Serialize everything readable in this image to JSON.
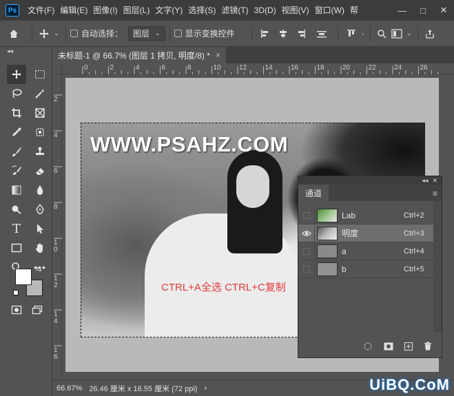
{
  "app": {
    "logo_text": "Ps"
  },
  "menu": [
    "文件(F)",
    "编辑(E)",
    "图像(I)",
    "图层(L)",
    "文字(Y)",
    "选择(S)",
    "滤镜(T)",
    "3D(D)",
    "视图(V)",
    "窗口(W)",
    "帮"
  ],
  "window_controls": {
    "minimize": "—",
    "maximize": "□",
    "close": "✕"
  },
  "options": {
    "auto_select_label": "自动选择：",
    "layer_select_value": "图层",
    "show_transform_label": "显示变换控件"
  },
  "document_tab": {
    "title": "未标题-1 @ 66.7% (图层 1 拷贝, 明度/8) *",
    "close": "×"
  },
  "ruler": {
    "h_ticks": [
      "0",
      "2",
      "4",
      "6",
      "8",
      "10",
      "12",
      "14",
      "16",
      "18",
      "20",
      "22",
      "24",
      "26"
    ],
    "v_ticks": [
      "2",
      "4",
      "6",
      "8",
      "1\n0",
      "1\n2",
      "1\n4",
      "1\n6"
    ]
  },
  "canvas": {
    "watermark": "WWW.PSAHZ.COM",
    "annotation": "CTRL+A全选 CTRL+C复制",
    "annotation_color": "#e03a3a"
  },
  "channels_panel": {
    "tab_label": "通道",
    "collapse_glyph": "◂◂",
    "close_glyph": "✕",
    "menu_glyph": "≡",
    "channels": [
      {
        "name": "Lab",
        "shortcut": "Ctrl+2",
        "visible": false,
        "selected": false
      },
      {
        "name": "明度",
        "shortcut": "Ctrl+3",
        "visible": true,
        "selected": true
      },
      {
        "name": "a",
        "shortcut": "Ctrl+4",
        "visible": false,
        "selected": false
      },
      {
        "name": "b",
        "shortcut": "Ctrl+5",
        "visible": false,
        "selected": false
      }
    ]
  },
  "toolbar": {
    "collapse_glyph": "◂◂"
  },
  "status": {
    "zoom": "66.67%",
    "doc_size": "26.46 厘米 x 16.55 厘米 (72 ppi)",
    "arrow": "›"
  },
  "site_logo": "UiBQ.CoM"
}
